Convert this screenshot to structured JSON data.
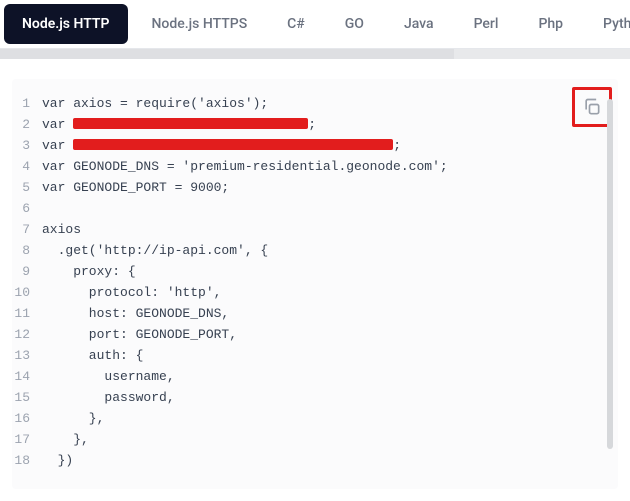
{
  "tabs": {
    "items": [
      {
        "label": "Node.js HTTP",
        "active": true
      },
      {
        "label": "Node.js HTTPS",
        "active": false
      },
      {
        "label": "C#",
        "active": false
      },
      {
        "label": "GO",
        "active": false
      },
      {
        "label": "Java",
        "active": false
      },
      {
        "label": "Perl",
        "active": false
      },
      {
        "label": "Php",
        "active": false
      },
      {
        "label": "Pytho",
        "active": false
      }
    ]
  },
  "code": {
    "lines": [
      {
        "n": "1",
        "text": "var axios = require('axios');"
      },
      {
        "n": "2",
        "prefix": "var ",
        "redacted": "short",
        "suffix": ";"
      },
      {
        "n": "3",
        "prefix": "var ",
        "redacted": "long",
        "suffix": ";"
      },
      {
        "n": "4",
        "text": "var GEONODE_DNS = 'premium-residential.geonode.com';"
      },
      {
        "n": "5",
        "text": "var GEONODE_PORT = 9000;"
      },
      {
        "n": "6",
        "text": ""
      },
      {
        "n": "7",
        "text": "axios"
      },
      {
        "n": "8",
        "text": "  .get('http://ip-api.com', {"
      },
      {
        "n": "9",
        "text": "    proxy: {"
      },
      {
        "n": "10",
        "text": "      protocol: 'http',"
      },
      {
        "n": "11",
        "text": "      host: GEONODE_DNS,"
      },
      {
        "n": "12",
        "text": "      port: GEONODE_PORT,"
      },
      {
        "n": "13",
        "text": "      auth: {"
      },
      {
        "n": "14",
        "text": "        username,"
      },
      {
        "n": "15",
        "text": "        password,"
      },
      {
        "n": "16",
        "text": "      },"
      },
      {
        "n": "17",
        "text": "    },"
      },
      {
        "n": "18",
        "text": "  })"
      }
    ]
  },
  "icons": {
    "copy": "copy"
  }
}
